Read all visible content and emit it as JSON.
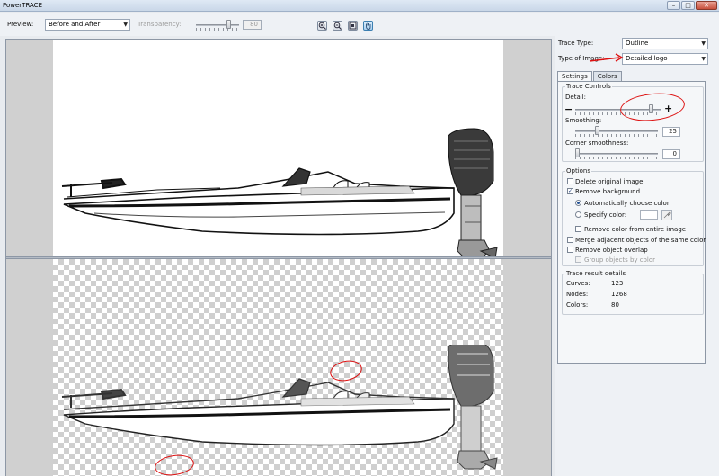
{
  "window": {
    "title": "PowerTRACE",
    "controls": [
      "–",
      "□",
      "✕"
    ]
  },
  "toolbar": {
    "preview_label": "Preview:",
    "preview_value": "Before and After",
    "transparency_label": "Transparency:",
    "transparency_value": "80",
    "buttons": [
      "zoom-in-icon",
      "zoom-out-icon",
      "fit-to-window-icon",
      "pan-hand-icon"
    ]
  },
  "right": {
    "trace_type_label": "Trace Type:",
    "trace_type_value": "Outline",
    "image_type_label": "Type of Image:",
    "image_type_value": "Detailed logo",
    "tabs": [
      "Settings",
      "Colors"
    ],
    "trace_controls": {
      "title": "Trace Controls",
      "detail_label": "Detail:",
      "minus": "−",
      "plus": "+",
      "smoothing_label": "Smoothing:",
      "smoothing_value": "25",
      "corner_label": "Corner smoothness:",
      "corner_value": "0",
      "detail_level": 0.9,
      "smoothing_level": 0.25,
      "corner_level": 0.0
    },
    "options": {
      "title": "Options",
      "delete_original": {
        "label": "Delete original image",
        "checked": false
      },
      "remove_background": {
        "label": "Remove background",
        "checked": true
      },
      "auto_color": {
        "label": "Automatically choose color",
        "selected": true
      },
      "specify_color": {
        "label": "Specify color:",
        "selected": false
      },
      "remove_entire": {
        "label": "Remove color from entire image",
        "checked": false
      },
      "merge_adjacent": {
        "label": "Merge adjacent objects of the same color",
        "checked": false
      },
      "remove_overlap": {
        "label": "Remove object overlap",
        "checked": false
      },
      "group_by_color": {
        "label": "Group objects by color",
        "checked": false
      }
    },
    "results": {
      "title": "Trace result details",
      "curves_label": "Curves:",
      "curves_value": "123",
      "nodes_label": "Nodes:",
      "nodes_value": "1268",
      "colors_label": "Colors:",
      "colors_value": "80"
    }
  },
  "colors": {
    "annotation": "#d11111",
    "accent": "#3c7fb1"
  }
}
